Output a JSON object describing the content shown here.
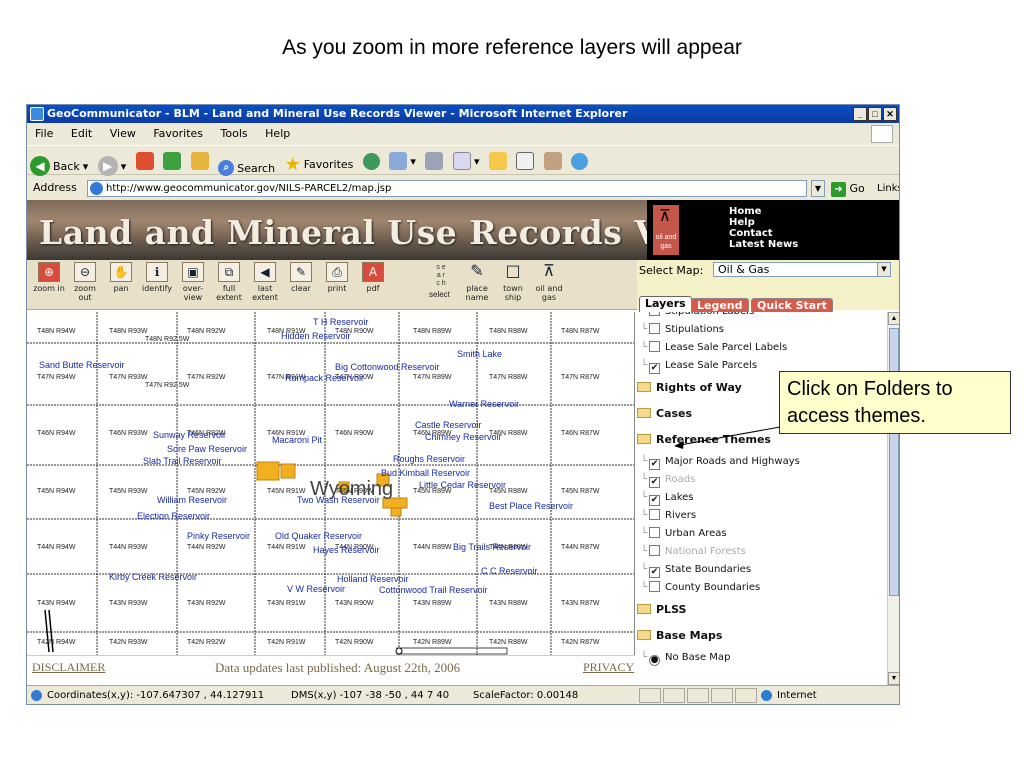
{
  "slide": {
    "heading": "As you zoom in more reference layers will appear"
  },
  "browser": {
    "title": "GeoCommunicator - BLM - Land and Mineral Use Records Viewer - Microsoft Internet Explorer",
    "menu": [
      "File",
      "Edit",
      "View",
      "Favorites",
      "Tools",
      "Help"
    ],
    "toolbar": {
      "back": "Back",
      "search": "Search",
      "favorites": "Favorites"
    },
    "address_label": "Address",
    "url": "http://www.geocommunicator.gov/NILS-PARCEL2/map.jsp",
    "go": "Go",
    "links": "Links"
  },
  "viewer": {
    "banner_title": "Land and Mineral Use Records Viewer",
    "logo_text": "oil and gas",
    "top_links": [
      "Home",
      "Help",
      "Contact",
      "Latest News"
    ],
    "tools": [
      {
        "icon": "zoom-in-icon",
        "glyph": "⊕",
        "label": "zoom in",
        "red": true
      },
      {
        "icon": "zoom-out-icon",
        "glyph": "⊖",
        "label": "zoom out",
        "red": false
      },
      {
        "icon": "pan-icon",
        "glyph": "✋",
        "label": "pan",
        "red": false
      },
      {
        "icon": "identify-icon",
        "glyph": "ℹ",
        "label": "identify",
        "red": false
      },
      {
        "icon": "overview-icon",
        "glyph": "▣",
        "label": "over- view",
        "red": false
      },
      {
        "icon": "full-extent-icon",
        "glyph": "⧉",
        "label": "full extent",
        "red": false
      },
      {
        "icon": "last-extent-icon",
        "glyph": "◀",
        "label": "last extent",
        "red": false
      },
      {
        "icon": "clear-icon",
        "glyph": "✎",
        "label": "clear",
        "red": false
      },
      {
        "icon": "print-icon",
        "glyph": "⎙",
        "label": "print",
        "red": false
      },
      {
        "icon": "pdf-icon",
        "glyph": "A",
        "label": "pdf",
        "red": true
      }
    ],
    "select_label": "select",
    "vertical_search": "s e a r c h",
    "search_tools": [
      {
        "icon": "place-name-icon",
        "glyph": "✎",
        "label": "place name"
      },
      {
        "icon": "township-icon",
        "glyph": "□",
        "label": "town ship"
      },
      {
        "icon": "oil-gas-icon",
        "glyph": "⊼",
        "label": "oil and gas"
      }
    ],
    "select_map_label": "Select Map:",
    "select_map_value": "Oil & Gas",
    "tabs": [
      "Layers",
      "Legend",
      "Quick Start"
    ],
    "layers": [
      {
        "type": "item",
        "label": "Stipulation Labels",
        "checked": false,
        "dim": false
      },
      {
        "type": "item",
        "label": "Stipulations",
        "checked": false,
        "dim": false
      },
      {
        "type": "item",
        "label": "Lease Sale Parcel Labels",
        "checked": false,
        "dim": false
      },
      {
        "type": "item",
        "label": "Lease Sale Parcels",
        "checked": true,
        "dim": false
      },
      {
        "type": "folder",
        "label": "Rights of Way",
        "open": false
      },
      {
        "type": "folder",
        "label": "Cases",
        "open": false
      },
      {
        "type": "folder",
        "label": "Reference Themes",
        "open": true
      },
      {
        "type": "item",
        "label": "Major Roads and Highways",
        "checked": true,
        "dim": false
      },
      {
        "type": "item",
        "label": "Roads",
        "checked": true,
        "dim": true
      },
      {
        "type": "item",
        "label": "Lakes",
        "checked": true,
        "dim": false
      },
      {
        "type": "item",
        "label": "Rivers",
        "checked": false,
        "dim": false
      },
      {
        "type": "item",
        "label": "Urban Areas",
        "checked": false,
        "dim": false
      },
      {
        "type": "item",
        "label": "National Forests",
        "checked": false,
        "dim": true
      },
      {
        "type": "item",
        "label": "State Boundaries",
        "checked": true,
        "dim": false
      },
      {
        "type": "item",
        "label": "County Boundaries",
        "checked": false,
        "dim": false
      },
      {
        "type": "folder",
        "label": "PLSS",
        "open": false
      },
      {
        "type": "folder",
        "label": "Base Maps",
        "open": true
      },
      {
        "type": "radio",
        "label": "No Base Map",
        "checked": true,
        "dim": false
      }
    ],
    "footer": {
      "disclaimer": "DISCLAIMER",
      "last_published": "Data updates last published: August 22th, 2006",
      "privacy": "PRIVACY"
    }
  },
  "map": {
    "township_cols": [
      "R94W",
      "R93W",
      "R92W",
      "R91W",
      "R90W",
      "R89W",
      "R88W",
      "R87W"
    ],
    "township_rows": [
      "T48N",
      "T47N",
      "T46N",
      "T45N",
      "T44N",
      "T43N",
      "T42N"
    ],
    "extra_labels": [
      "T48N R92.5W",
      "T47N R92.5W"
    ],
    "places": [
      "T H Reservoir",
      "Hidden Reservoir",
      "Sand Butte Reservoir",
      "Big Cottonwood Reservoir",
      "Smith Lake",
      "Rumpack Reservoir",
      "Warner Reservoir",
      "Castle Reservoir",
      "Chimney Reservoir",
      "Sunway Reservoir",
      "Sore Paw Reservoir",
      "Macaroni Pit",
      "Slab Trail Reservoir",
      "Roughs Reservoir",
      "Bud Kimball Reservoir",
      "Little Cedar Reservoir",
      "Wyoming",
      "William Reservoir",
      "Two Wash Reservoir",
      "Best Place Reservoir",
      "Election Reservoir",
      "Pinky Reservoir",
      "Old Quaker Reservoir",
      "Hayes Reservoir",
      "Big Trails Reservoir",
      "Kirby Creek Reservoir",
      "C C Reservoir",
      "Holland Reservoir",
      "V W Reservoir",
      "Cottonwood Trail Reservoir"
    ]
  },
  "status": {
    "coords": "Coordinates(x,y): -107.647307 , 44.127911",
    "dms": "DMS(x,y) -107  -38  -50  ,  44  7  40",
    "scale": "ScaleFactor: 0.00148",
    "zone": "Internet"
  },
  "callout": {
    "line1": "Click on Folders to",
    "line2": "access themes."
  }
}
